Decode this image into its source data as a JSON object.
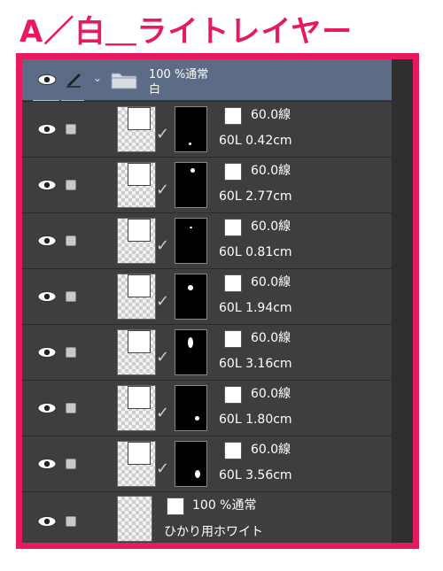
{
  "caption": "A／白＿ライトレイヤー",
  "folder": {
    "blend": "100 %通常",
    "name": "白",
    "icons": {
      "visibility": "eye-icon",
      "edit": "pen-icon",
      "expand": "chevron-down-icon",
      "folder": "folder-icon"
    }
  },
  "layers": [
    {
      "opacity_label": "60.0線",
      "detail": "60L 0.42cm"
    },
    {
      "opacity_label": "60.0線",
      "detail": "60L 2.77cm"
    },
    {
      "opacity_label": "60.0線",
      "detail": "60L 0.81cm"
    },
    {
      "opacity_label": "60.0線",
      "detail": "60L 1.94cm"
    },
    {
      "opacity_label": "60.0線",
      "detail": "60L 3.16cm"
    },
    {
      "opacity_label": "60.0線",
      "detail": "60L 1.80cm"
    },
    {
      "opacity_label": "60.0線",
      "detail": "60L 3.56cm"
    }
  ],
  "base_layer": {
    "blend": "100 %通常",
    "name": "ひかり用ホワイト"
  },
  "colors": {
    "accent": "#e8195e",
    "panel_bg": "#3e3e3e",
    "folder_row": "#5d6c86"
  }
}
